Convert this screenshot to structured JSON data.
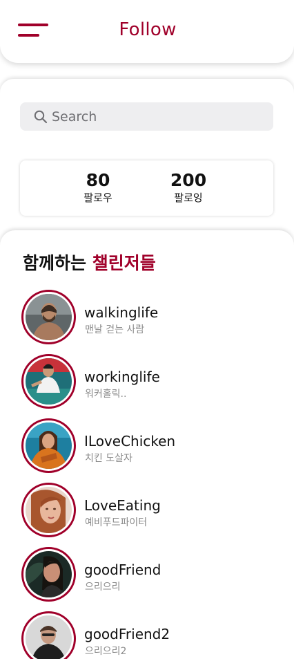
{
  "header": {
    "title": "Follow",
    "menu_icon": "hamburger-menu-icon"
  },
  "search": {
    "placeholder": "Search",
    "icon": "search-icon"
  },
  "stats": {
    "followers_count": "80",
    "followers_label": "팔로우",
    "following_count": "200",
    "following_label": "팔로잉"
  },
  "challengers": {
    "title_prefix": "함께하는",
    "title_accent": "챌린저들",
    "items": [
      {
        "name": "walkinglife",
        "bio": "맨날 걷는 사람"
      },
      {
        "name": "workinglife",
        "bio": "워커홀릭.."
      },
      {
        "name": "ILoveChicken",
        "bio": "치킨 도살자"
      },
      {
        "name": "LoveEating",
        "bio": "예비푸드파이터"
      },
      {
        "name": "goodFriend",
        "bio": "으리으리"
      },
      {
        "name": "goodFriend2",
        "bio": "으리으리2"
      }
    ]
  },
  "colors": {
    "accent": "#a0002a",
    "search_bg": "#eeeef0",
    "muted_text": "#8a8a8a"
  }
}
